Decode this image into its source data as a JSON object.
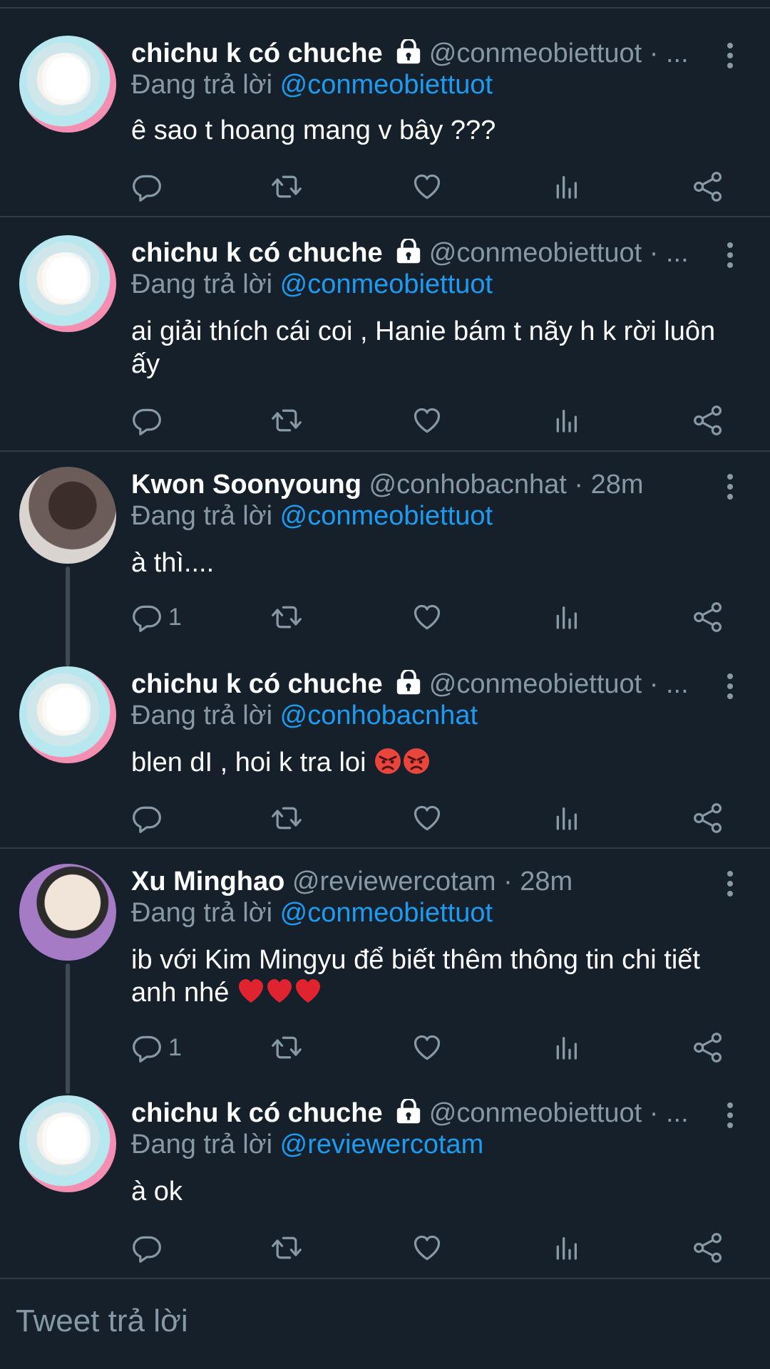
{
  "tweets": [
    {
      "name": "chichu k có chuche",
      "handle": "@conmeobiettuot · ...",
      "reply_prefix": "Đang trả lời",
      "reply_to": "@conmeobiettuot",
      "text": "ê sao t hoang mang v bây ???",
      "reply_count": ""
    },
    {
      "name": "chichu k có chuche",
      "handle": "@conmeobiettuot · ...",
      "reply_prefix": "Đang trả lời",
      "reply_to": "@conmeobiettuot",
      "text": "ai giải thích cái coi , Hanie bám t nãy h k rời luôn ấy",
      "reply_count": ""
    },
    {
      "name": "Kwon Soonyoung",
      "handle": "@conhobacnhat · 28m",
      "reply_prefix": "Đang trả lời",
      "reply_to": "@conmeobiettuot",
      "text": "à thì....",
      "reply_count": "1"
    },
    {
      "name": "chichu k có chuche",
      "handle": "@conmeobiettuot · ...",
      "reply_prefix": "Đang trả lời",
      "reply_to": "@conhobacnhat",
      "text": "blen dI , hoi k tra loi",
      "reply_count": ""
    },
    {
      "name": "Xu Minghao",
      "handle": "@reviewercotam · 28m",
      "reply_prefix": "Đang trả lời",
      "reply_to": "@conmeobiettuot",
      "text": "ib với Kim Mingyu để biết thêm thông tin chi tiết anh nhé",
      "reply_count": "1"
    },
    {
      "name": "chichu k có chuche",
      "handle": "@conmeobiettuot · ...",
      "reply_prefix": "Đang trả lời",
      "reply_to": "@reviewercotam",
      "text": "à ok",
      "reply_count": ""
    }
  ],
  "composer": {
    "placeholder": "Tweet trả lời"
  },
  "colors": {
    "background": "#15202b",
    "accent": "#1d9bf0",
    "muted": "#8899a6",
    "divider": "#2f3b46"
  },
  "icons": [
    "lock-icon",
    "more-icon",
    "reply-icon",
    "retweet-icon",
    "like-icon",
    "analytics-icon",
    "share-icon",
    "angry-face-emoji",
    "red-heart-emoji"
  ]
}
